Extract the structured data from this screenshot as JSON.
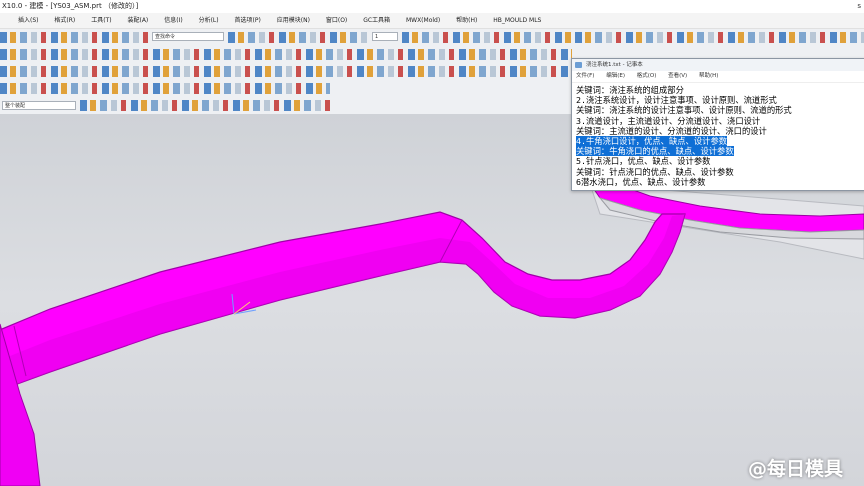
{
  "window": {
    "title": "X10.0 - 建模 - [YS03_ASM.prt （修改的）]",
    "corner_text": "s"
  },
  "menu": [
    "插入(S)",
    "格式(R)",
    "工具(T)",
    "装配(A)",
    "信息(I)",
    "分析(L)",
    "首选项(P)",
    "应用模块(N)",
    "窗口(O)",
    "GC工具箱",
    "MWX(Mold)",
    "帮助(H)",
    "HB_MOULD MLS"
  ],
  "toolbar": {
    "command_search": "查找命令",
    "layer_value": "1",
    "selection_filter": "整个装配"
  },
  "notepad": {
    "title": "浇注系统1.txt - 记事本",
    "menu": [
      "文件(F)",
      "编辑(E)",
      "格式(O)",
      "查看(V)",
      "帮助(H)"
    ],
    "lines": [
      "关键词：浇注系统的组成部分",
      "2.浇注系统设计，设计注意事项、设计原则、流道形式",
      "关键词：浇注系统的设计注意事项、设计原则、流道的形式",
      "3.流道设计，主流道设计、分流道设计、浇口设计",
      "关键词：主流道的设计、分流道的设计、浇口的设计",
      "4.牛角浇口设计，优点、缺点、设计参数",
      "关键词：牛角浇口的优点、缺点、设计参数",
      "5.针点浇口，优点、缺点、设计参数",
      "关键词：针点浇口的优点、缺点、设计参数",
      "6潜水浇口，优点、缺点、设计参数"
    ],
    "selected_lines": [
      5,
      6
    ]
  },
  "watermark": "@每日模具",
  "colors": {
    "part": "#ff00ff",
    "part_shade": "#c000c4",
    "selection": "#0f6fd6",
    "viewport_bg": "#d6d8dc"
  }
}
